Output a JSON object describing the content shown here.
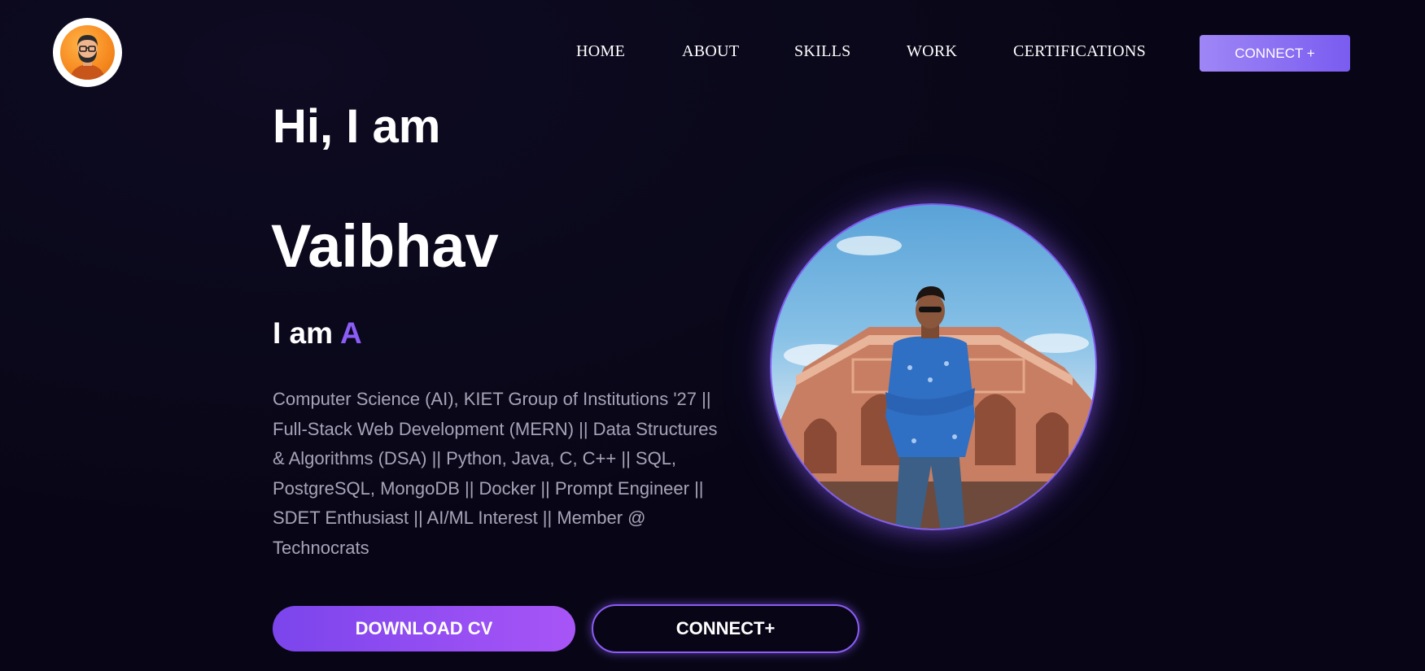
{
  "header": {
    "logo_icon": "avatar-logo-icon",
    "nav": [
      {
        "label": "HOME"
      },
      {
        "label": "ABOUT"
      },
      {
        "label": "SKILLS"
      },
      {
        "label": "WORK"
      },
      {
        "label": "CERTIFICATIONS"
      }
    ],
    "connect_label": "CONNECT +"
  },
  "hero": {
    "greeting": "Hi, I am",
    "name": "Vaibhav",
    "role_prefix": "I am",
    "role_typed": "A",
    "bio": "Computer Science (AI), KIET Group of Institutions '27 || Full-Stack Web Development (MERN) || Data Structures & Algorithms (DSA) || Python, Java, C, C++ || SQL, PostgreSQL, MongoDB || Docker || Prompt Engineer || SDET Enthusiast || AI/ML Interest || Member @ Technocrats",
    "download_cv_label": "DOWNLOAD CV",
    "connect_label": "CONNECT+",
    "portrait_icon": "profile-photo"
  },
  "colors": {
    "background": "#080616",
    "accent": "#8b5cf6",
    "text_muted": "#a7a3b8"
  }
}
